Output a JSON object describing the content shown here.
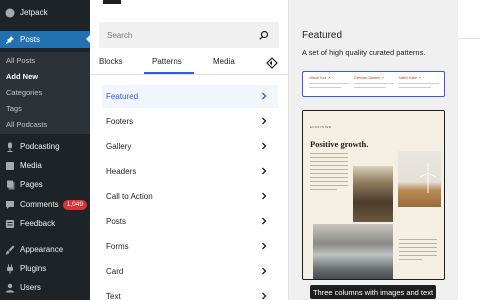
{
  "admin_menu": {
    "items": [
      {
        "label": "Jetpack",
        "icon": "jetpack-icon"
      },
      {
        "label": "Posts",
        "icon": "pin-icon",
        "active": true
      },
      {
        "label": "Podcasting",
        "icon": "microphone-icon"
      },
      {
        "label": "Media",
        "icon": "media-icon"
      },
      {
        "label": "Pages",
        "icon": "pages-icon"
      },
      {
        "label": "Comments",
        "icon": "comment-icon",
        "badge": "1,049"
      },
      {
        "label": "Feedback",
        "icon": "feedback-icon"
      },
      {
        "label": "Appearance",
        "icon": "brush-icon"
      },
      {
        "label": "Plugins",
        "icon": "plugin-icon"
      },
      {
        "label": "Users",
        "icon": "users-icon"
      }
    ],
    "submenu": [
      "All Posts",
      "Add New",
      "Categories",
      "Tags",
      "All Podcasts"
    ],
    "current_submenu": "Add New",
    "accent": "#2271b1",
    "badge_color": "#d63638"
  },
  "inserter": {
    "search_placeholder": "Search",
    "tabs": [
      "Blocks",
      "Patterns",
      "Media"
    ],
    "active_tab": "Patterns",
    "categories": [
      "Featured",
      "Footers",
      "Gallery",
      "Headers",
      "Call to Action",
      "Posts",
      "Forms",
      "Card",
      "Text"
    ],
    "selected_category": "Featured",
    "accent": "#3858e9"
  },
  "preview": {
    "title": "Featured",
    "description": "A set of high quality curated patterns.",
    "card1_columns": [
      "Virtual Tour ↗",
      "Gemma Glasses ↗",
      "Nakhl Halle ↗"
    ],
    "card2_heading": "Positive growth.",
    "card2_kicker": "ECOSYSTEM",
    "tooltip": "Three columns with images and text"
  }
}
